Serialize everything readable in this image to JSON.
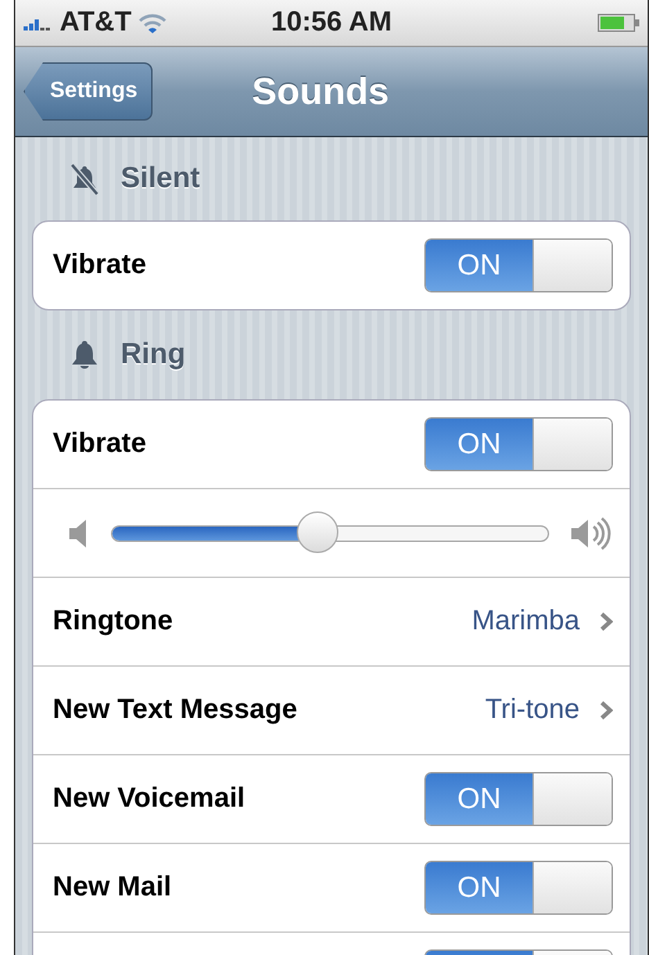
{
  "status_bar": {
    "carrier": "AT&T",
    "time": "10:56 AM"
  },
  "nav_bar": {
    "back_button": "Settings",
    "title": "Sounds"
  },
  "sections": [
    {
      "header": "Silent",
      "kind": "muted",
      "rows": [
        {
          "kind": "toggle",
          "label": "Vibrate",
          "on": true,
          "switch_text": "ON"
        }
      ]
    },
    {
      "header": "Ring",
      "kind": "ring",
      "rows": [
        {
          "kind": "toggle",
          "label": "Vibrate",
          "on": true,
          "switch_text": "ON"
        },
        {
          "kind": "slider",
          "level": 0.47
        },
        {
          "kind": "detail",
          "label": "Ringtone",
          "value": "Marimba"
        },
        {
          "kind": "detail",
          "label": "New Text Message",
          "value": "Tri-tone"
        },
        {
          "kind": "toggle",
          "label": "New Voicemail",
          "on": true,
          "switch_text": "ON"
        },
        {
          "kind": "toggle",
          "label": "New Mail",
          "on": true,
          "switch_text": "ON"
        },
        {
          "kind": "toggle",
          "on": true
        }
      ]
    }
  ]
}
